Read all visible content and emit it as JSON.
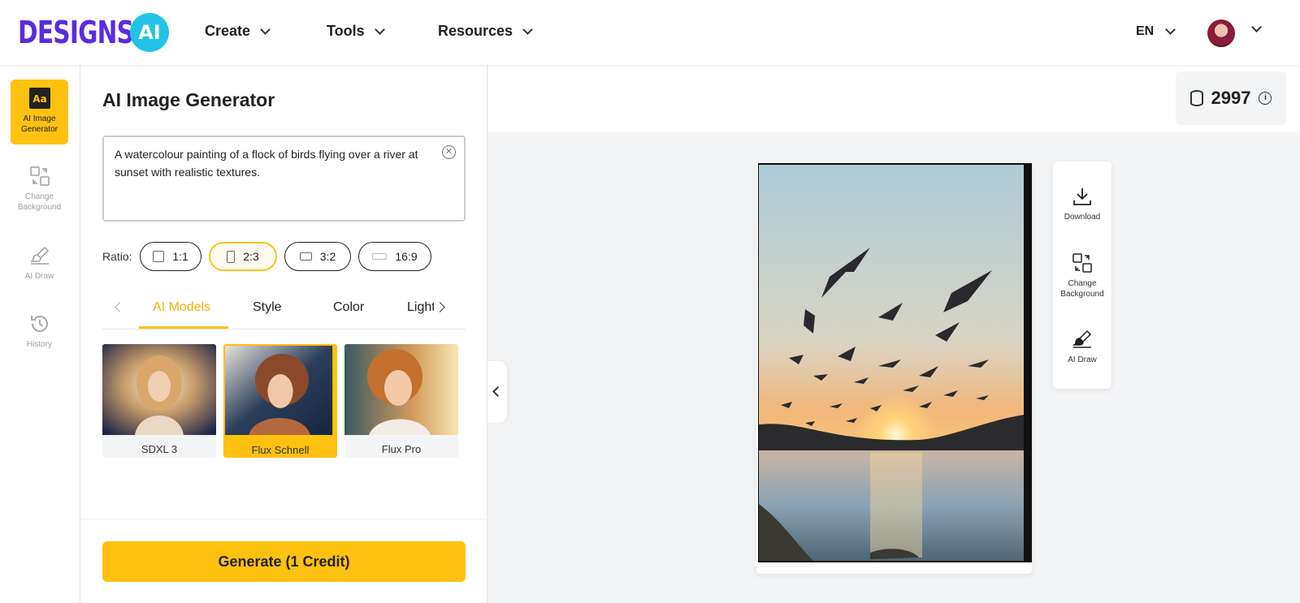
{
  "header": {
    "logo_text": "DESIGNS.",
    "logo_badge": "AI",
    "nav": [
      {
        "label": "Create"
      },
      {
        "label": "Tools"
      },
      {
        "label": "Resources"
      }
    ],
    "language": "EN",
    "avatar_icon": "user-avatar"
  },
  "sidebar": {
    "items": [
      {
        "label": "AI Image Generator",
        "icon": "text-aa-icon",
        "active": true
      },
      {
        "label": "Change Background",
        "icon": "swap-images-icon"
      },
      {
        "label": "AI Draw",
        "icon": "brush-icon"
      },
      {
        "label": "History",
        "icon": "history-icon"
      }
    ]
  },
  "panel": {
    "title": "AI Image Generator",
    "prompt": "A watercolour painting of a flock of birds flying over a river at sunset with realistic textures.",
    "ratio_label": "Ratio:",
    "ratios": [
      {
        "label": "1:1"
      },
      {
        "label": "2:3",
        "selected": true
      },
      {
        "label": "3:2"
      },
      {
        "label": "16:9"
      }
    ],
    "tabs": [
      {
        "label": "AI Models",
        "active": true
      },
      {
        "label": "Style"
      },
      {
        "label": "Color"
      },
      {
        "label": "Lighting"
      }
    ],
    "models": [
      {
        "label": "SDXL 3"
      },
      {
        "label": "Flux Schnell",
        "selected": true
      },
      {
        "label": "Flux Pro"
      }
    ],
    "generate_label": "Generate (1 Credit)"
  },
  "credits": {
    "value": "2997",
    "icon": "coins-icon"
  },
  "tools": [
    {
      "label": "Download",
      "icon": "download-icon"
    },
    {
      "label": "Change Background",
      "icon": "swap-images-icon"
    },
    {
      "label": "AI Draw",
      "icon": "brush-icon"
    }
  ],
  "colors": {
    "accent": "#fec10f",
    "brand": "#5b2be0",
    "brand_badge": "#22c3e6"
  }
}
